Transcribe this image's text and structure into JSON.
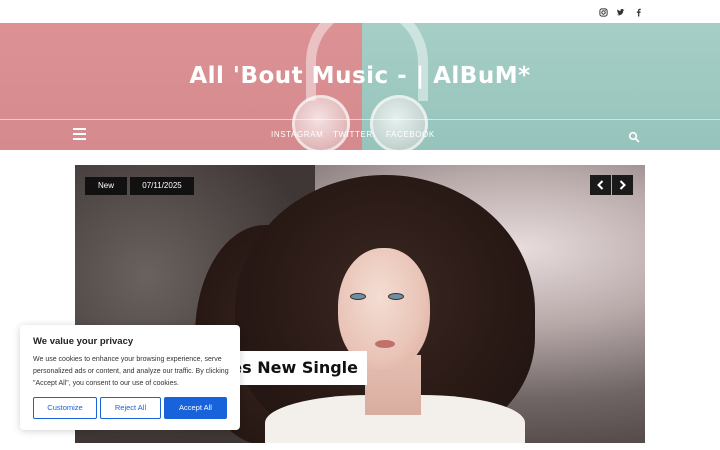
{
  "social": {
    "icons": [
      "instagram-icon",
      "twitter-icon",
      "facebook-icon"
    ]
  },
  "header": {
    "site_title": "All 'Bout Music - | AlBuM*",
    "nav": [
      "INSTAGRAM",
      "TWITTER",
      "FACEBOOK"
    ]
  },
  "hero": {
    "category": "New",
    "date": "07/11/2025",
    "title": "ses New Single"
  },
  "cookie": {
    "title": "We value your privacy",
    "text": "We use cookies to enhance your browsing experience, serve personalized ads or content, and analyze our traffic. By clicking \"Accept All\", you consent to our use of cookies.",
    "customize": "Customize",
    "reject": "Reject All",
    "accept": "Accept All"
  },
  "colors": {
    "accent_button": "#1863dc",
    "header_pink": "#d78d90",
    "header_teal": "#96c4bc",
    "badge_bg": "#111111"
  }
}
